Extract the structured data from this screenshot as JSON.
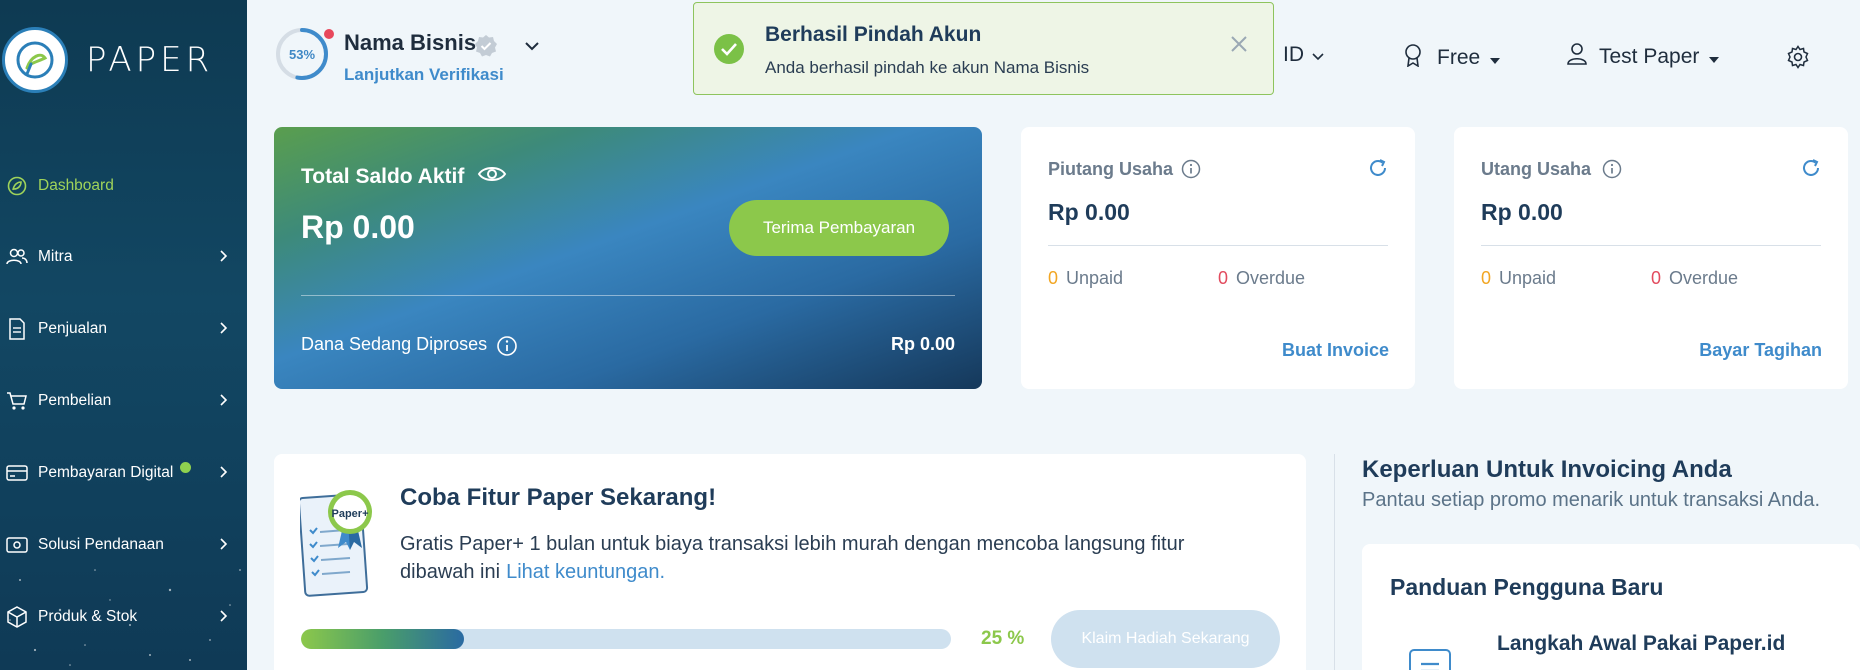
{
  "app": {
    "logo_text": "PAPER"
  },
  "sidebar": {
    "items": [
      {
        "label": "Dashboard",
        "icon": "leaf-icon"
      },
      {
        "label": "Mitra",
        "icon": "users-icon"
      },
      {
        "label": "Penjualan",
        "icon": "document-icon"
      },
      {
        "label": "Pembelian",
        "icon": "cart-icon"
      },
      {
        "label": "Pembayaran Digital",
        "icon": "card-icon"
      },
      {
        "label": "Solusi Pendanaan",
        "icon": "cash-icon"
      },
      {
        "label": "Produk & Stok",
        "icon": "box-icon"
      }
    ]
  },
  "header": {
    "verification_percent": "53%",
    "verification_progress": 0.53,
    "business_name": "Nama Bisnis",
    "verify_link": "Lanjutkan Verifikasi",
    "language": "ID",
    "plan": "Free",
    "user": "Test Paper"
  },
  "toast": {
    "title": "Berhasil Pindah Akun",
    "message": "Anda berhasil pindah ke akun Nama Bisnis"
  },
  "saldo": {
    "title": "Total Saldo Aktif",
    "amount": "Rp 0.00",
    "button": "Terima Pembayaran",
    "processing_label": "Dana Sedang Diproses",
    "processing_amount": "Rp 0.00"
  },
  "piutang": {
    "title": "Piutang Usaha",
    "amount": "Rp 0.00",
    "unpaid_count": "0",
    "unpaid_label": "Unpaid",
    "overdue_count": "0",
    "overdue_label": "Overdue",
    "action": "Buat Invoice"
  },
  "utang": {
    "title": "Utang Usaha",
    "amount": "Rp 0.00",
    "unpaid_count": "0",
    "unpaid_label": "Unpaid",
    "overdue_count": "0",
    "overdue_label": "Overdue",
    "action": "Bayar Tagihan"
  },
  "promo": {
    "badge": "Paper+",
    "title": "Coba Fitur Paper Sekarang!",
    "description": "Gratis Paper+ 1 bulan untuk biaya transaksi lebih murah dengan mencoba langsung fitur dibawah ini",
    "link": "Lihat keuntungan.",
    "progress_label": "25 %",
    "progress": 0.25,
    "button": "Klaim Hadiah Sekarang"
  },
  "invoicing": {
    "title": "Keperluan Untuk Invoicing Anda",
    "subtitle": "Pantau setiap promo menarik untuk transaksi Anda.",
    "guide_title": "Panduan Pengguna Baru",
    "guide_item": "Langkah Awal Pakai Paper.id"
  },
  "colors": {
    "sidebar_bg": "#124763",
    "accent_green": "#8cc84b",
    "link_blue": "#3f8bcb",
    "warning_yellow": "#f2a623",
    "danger_red": "#e24b5e"
  }
}
